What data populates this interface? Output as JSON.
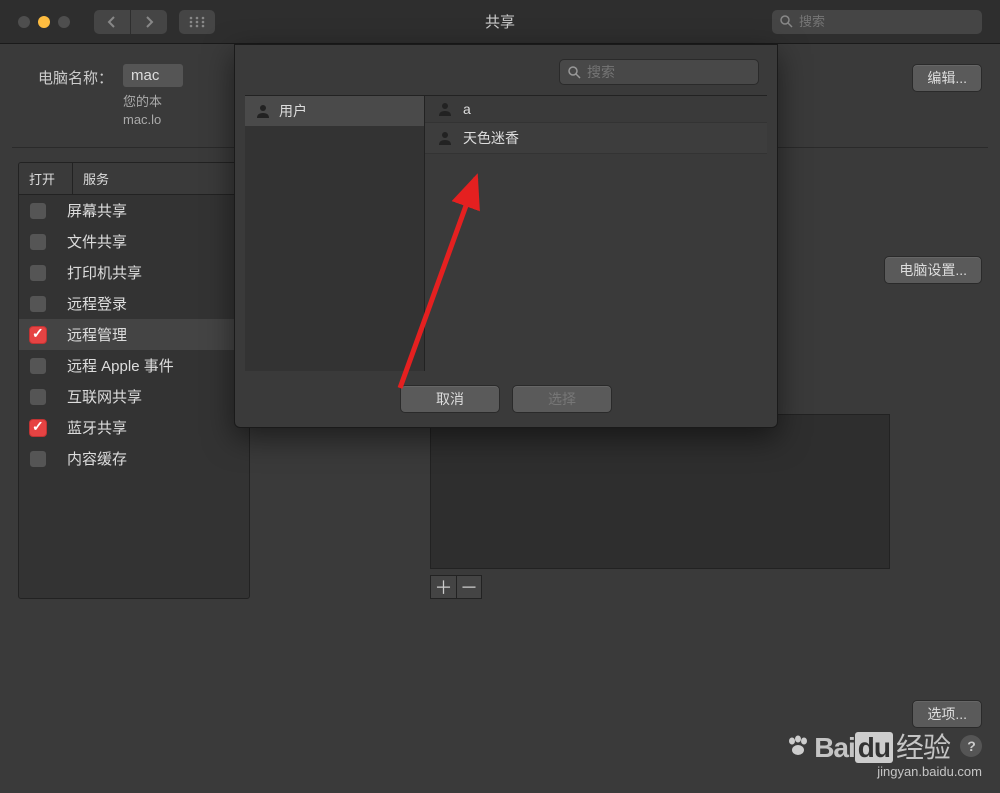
{
  "titlebar": {
    "title": "共享",
    "search_placeholder": "搜索"
  },
  "computer_name": {
    "label": "电脑名称：",
    "value": "mac",
    "desc_line1": "您的本",
    "desc_line2": "mac.lo",
    "edit_label": "编辑..."
  },
  "services": {
    "header_on": "打开",
    "header_service": "服务",
    "items": [
      {
        "label": "屏幕共享",
        "checked": false
      },
      {
        "label": "文件共享",
        "checked": false
      },
      {
        "label": "打印机共享",
        "checked": false
      },
      {
        "label": "远程登录",
        "checked": false
      },
      {
        "label": "远程管理",
        "checked": true,
        "selected": true
      },
      {
        "label": "远程 Apple 事件",
        "checked": false
      },
      {
        "label": "互联网共享",
        "checked": false
      },
      {
        "label": "蓝牙共享",
        "checked": true
      },
      {
        "label": "内容缓存",
        "checked": false
      }
    ]
  },
  "right_panel": {
    "computer_settings_label": "电脑设置...",
    "options_label": "选项...",
    "plus": "＋",
    "minus": "－"
  },
  "modal": {
    "search_placeholder": "搜索",
    "groups": [
      {
        "label": "用户"
      }
    ],
    "users": [
      {
        "label": "a"
      },
      {
        "label": "天色迷香"
      }
    ],
    "cancel_label": "取消",
    "select_label": "选择"
  },
  "watermark": {
    "brand1": "Bai",
    "brand2": "du",
    "brand3": "经验",
    "url": "jingyan.baidu.com",
    "help": "?"
  }
}
